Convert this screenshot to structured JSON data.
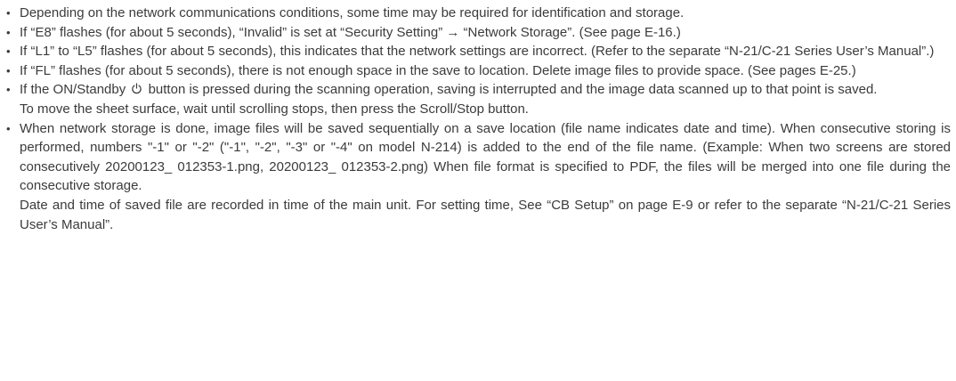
{
  "bullet_glyph": "•",
  "notes": [
    {
      "text": "Depending on the network communications conditions, some time may be required for identification and storage."
    },
    {
      "text": "If “E8” flashes (for about 5 seconds), “Invalid” is set at “Security Setting” → “Network Storage”. (See page E-16.)"
    },
    {
      "text": "If “L1” to “L5” flashes (for about 5 seconds), this indicates that the network settings are incorrect. (Refer to the separate “N-21/C-21 Series User’s Manual”.)"
    },
    {
      "text": "If “FL” flashes (for about 5 seconds), there is not enough space in the save to location. Delete image files to provide space. (See pages E-25.)"
    },
    {
      "text_before_icon": "If the ON/Standby",
      "icon": "power-icon",
      "text_after_icon": "button is pressed during the scanning operation, saving is interrupted and the image data scanned up to that point is saved.",
      "continuation": "To move the sheet surface, wait until scrolling stops, then press the Scroll/Stop button."
    },
    {
      "text": "When network storage is done, image files will be saved sequentially on a save location (file name indicates date and time). When consecutive storing is performed, numbers \"-1\" or \"-2\" (\"-1\", \"-2\", \"-3\" or \"-4\" on model N-214) is added to the end of the file name. (Example: When two screens are stored consecutively 20200123_ 012353-1.png, 20200123_ 012353-2.png) When file format is specified to PDF, the files will be merged into one file during the consecutive storage.",
      "continuation": "Date and time of saved file are recorded in time of the main unit. For setting time, See “CB Setup” on page E-9 or refer to the separate “N-21/C-21 Series User’s Manual”."
    }
  ]
}
